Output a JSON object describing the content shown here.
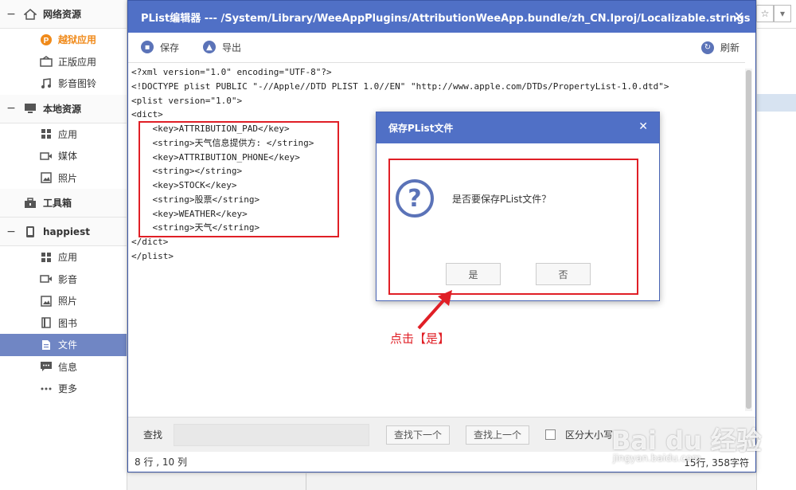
{
  "sidebar": {
    "groups": [
      {
        "label": "网络资源",
        "icon": "home-icon"
      },
      {
        "label": "本地资源",
        "icon": "monitor-icon"
      },
      {
        "label": "工具箱",
        "icon": "toolbox-icon"
      },
      {
        "label": "happiest",
        "icon": "phone-icon"
      }
    ],
    "net_items": [
      {
        "label": "越狱应用",
        "icon": "p-icon"
      },
      {
        "label": "正版应用",
        "icon": "app-store-icon"
      },
      {
        "label": "影音图铃",
        "icon": "music-icon"
      }
    ],
    "local_items": [
      {
        "label": "应用",
        "icon": "grid-icon"
      },
      {
        "label": "媒体",
        "icon": "video-icon"
      },
      {
        "label": "照片",
        "icon": "photo-icon"
      }
    ],
    "device_items": [
      {
        "label": "应用",
        "icon": "grid-icon"
      },
      {
        "label": "影音",
        "icon": "video-icon"
      },
      {
        "label": "照片",
        "icon": "photo-icon"
      },
      {
        "label": "图书",
        "icon": "book-icon"
      },
      {
        "label": "文件",
        "icon": "file-icon"
      },
      {
        "label": "信息",
        "icon": "message-icon"
      },
      {
        "label": "更多",
        "icon": "more-icon"
      }
    ]
  },
  "editor": {
    "title": "PList编辑器 --- /System/Library/WeeAppPlugins/AttributionWeeApp.bundle/zh_CN.lproj/Localizable.strings",
    "toolbar": {
      "save": "保存",
      "export": "导出",
      "refresh": "刷新"
    },
    "code_lines": [
      "<?xml version=\"1.0\" encoding=\"UTF-8\"?>",
      "<!DOCTYPE plist PUBLIC \"-//Apple//DTD PLIST 1.0//EN\" \"http://www.apple.com/DTDs/PropertyList-1.0.dtd\">",
      "<plist version=\"1.0\">",
      "<dict>",
      "    <key>ATTRIBUTION_PAD</key>",
      "    <string>天气信息提供方: </string>",
      "    <key>ATTRIBUTION_PHONE</key>",
      "    <string></string>",
      "    <key>STOCK</key>",
      "    <string>股票</string>",
      "    <key>WEATHER</key>",
      "    <string>天气</string>",
      "</dict>",
      "</plist>"
    ],
    "find": {
      "label": "查找",
      "input_value": "",
      "next": "查找下一个",
      "prev": "查找上一个",
      "case_label": "区分大小写"
    },
    "status": {
      "position": "8 行 , 10 列",
      "summary": "15行, 358字符"
    }
  },
  "dialog": {
    "title": "保存PList文件",
    "message": "是否要保存PList文件？",
    "yes": "是",
    "no": "否"
  },
  "annotation": "点击【是】",
  "watermark": {
    "main": "Bai du 经验",
    "sub": "jingyan.baidu.com"
  },
  "colors": {
    "title_bar": "#5070c6",
    "selected": "#7086c4",
    "highlight": "#e01f26",
    "accent_orange": "#f08a1a"
  }
}
